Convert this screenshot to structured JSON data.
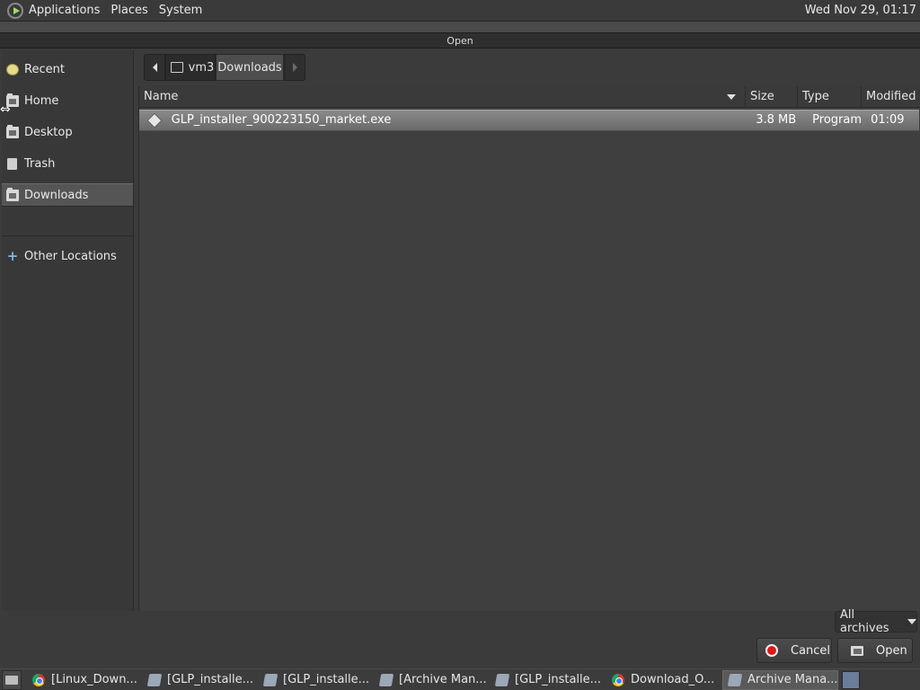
{
  "top_panel": {
    "menus": [
      "Applications",
      "Places",
      "System"
    ],
    "clock": "Wed Nov 29, 01:17"
  },
  "dialog": {
    "title": "Open"
  },
  "sidebar": {
    "items": [
      {
        "label": "Recent",
        "icon": "recent-icon"
      },
      {
        "label": "Home",
        "icon": "home-folder-icon"
      },
      {
        "label": "Desktop",
        "icon": "desktop-folder-icon"
      },
      {
        "label": "Trash",
        "icon": "trash-icon"
      },
      {
        "label": "Downloads",
        "icon": "folder-icon",
        "active": true
      },
      {
        "label": "Other Locations",
        "icon": "plus-icon"
      }
    ]
  },
  "pathbar": {
    "home_label": "vm3",
    "current_label": "Downloads"
  },
  "filelist": {
    "columns": [
      "Name",
      "Size",
      "Type",
      "Modified"
    ],
    "rows": [
      {
        "name": "GLP_installer_900223150_market.exe",
        "size": "3.8 MB",
        "type": "Program",
        "modified": "01:09"
      }
    ]
  },
  "filter": {
    "selected": "All archives"
  },
  "buttons": {
    "cancel": "Cancel",
    "open": "Open"
  },
  "taskbar": {
    "tasks": [
      {
        "label": "[Linux_Down...",
        "icon": "chrome-icon",
        "active": false
      },
      {
        "label": "[GLP_installe...",
        "icon": "archive-manager-icon",
        "active": false
      },
      {
        "label": "[GLP_installe...",
        "icon": "archive-manager-icon",
        "active": false
      },
      {
        "label": "[Archive Man...",
        "icon": "archive-manager-icon",
        "active": false
      },
      {
        "label": "[GLP_installe...",
        "icon": "archive-manager-icon",
        "active": false
      },
      {
        "label": "Download_O...",
        "icon": "chrome-icon",
        "active": false
      },
      {
        "label": "Archive Mana...",
        "icon": "archive-manager-icon",
        "active": true
      }
    ]
  }
}
